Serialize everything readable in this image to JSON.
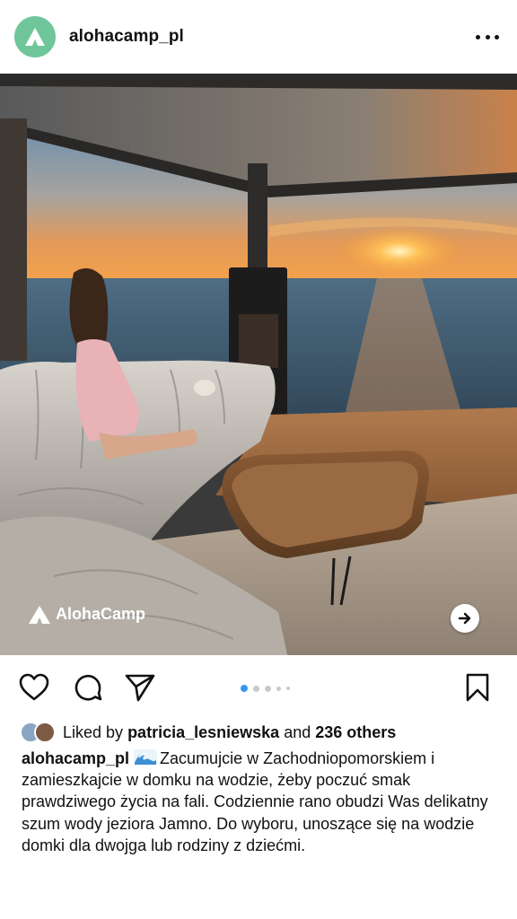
{
  "post": {
    "username": "alohacamp_pl",
    "brand_watermark": "AlohaCamp",
    "carousel": {
      "total": 5,
      "current": 1
    }
  },
  "likes": {
    "prefix": "Liked by",
    "user": "patricia_lesniewska",
    "joiner": "and",
    "others": "236 others"
  },
  "caption": {
    "author": "alohacamp_pl",
    "emoji": "water-wave-emoji",
    "text": "Zacumujcie w Zachodniopomorskiem i zamieszkajcie w domku na wodzie, żeby poczuć smak prawdziwego życia na fali. Codziennie rano obudzi Was delikatny szum wody jeziora Jamno. Do wyboru, unoszące się na wodzie domki dla dwojga lub rodziny z dziećmi."
  },
  "icons": {
    "avatar": "tent-logo-icon",
    "more": "more-options-icon",
    "like": "heart-icon",
    "comment": "comment-icon",
    "share": "send-icon",
    "save": "bookmark-icon",
    "next": "arrow-right-icon"
  },
  "colors": {
    "avatar_bg": "#6fc69a",
    "carousel_active": "#3897f0",
    "carousel_inactive": "#c9c9c9"
  }
}
